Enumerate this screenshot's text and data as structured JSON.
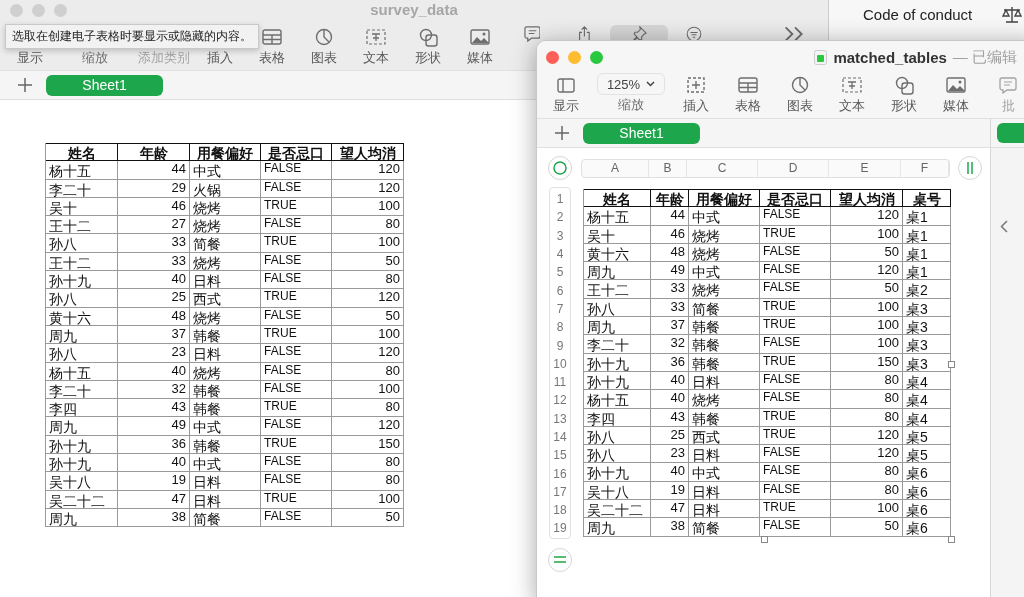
{
  "background_window": {
    "title": "Code of conduct"
  },
  "survey_window": {
    "title": "survey_data",
    "active": false,
    "tooltip": "选取在创建电子表格时要显示或隐藏的内容。",
    "toolbar": [
      {
        "label": "显示",
        "disabled": false
      },
      {
        "kind": "zoom",
        "label": "缩放",
        "disabled": false
      },
      {
        "label": "添加类别",
        "disabled": true
      },
      {
        "label": "插入",
        "disabled": false
      },
      {
        "kind": "table",
        "label": "表格",
        "disabled": false
      },
      {
        "kind": "chart",
        "label": "图表",
        "disabled": false
      },
      {
        "kind": "text",
        "label": "文本",
        "disabled": false
      },
      {
        "kind": "shape",
        "label": "形状",
        "disabled": false
      },
      {
        "kind": "media",
        "label": "媒体",
        "disabled": false
      }
    ],
    "more_tools": [
      {
        "kind": "comment",
        "on": false
      },
      {
        "kind": "share",
        "on": false
      },
      {
        "kind": "pin",
        "on": true
      },
      {
        "kind": "organize",
        "on": false
      },
      {
        "kind": "more",
        "on": false
      }
    ],
    "sheets": [
      {
        "label": "Sheet1",
        "selected": true
      }
    ],
    "table": {
      "columns": [
        {
          "label": "姓名",
          "kind": "text"
        },
        {
          "label": "年龄",
          "kind": "number"
        },
        {
          "label": "用餐偏好",
          "kind": "text"
        },
        {
          "label": "是否忌口",
          "kind": "bool"
        },
        {
          "label": "望人均消",
          "kind": "number"
        }
      ],
      "rows": [
        [
          "杨十五",
          "44",
          "中式",
          "FALSE",
          "120"
        ],
        [
          "李二十",
          "29",
          "火锅",
          "FALSE",
          "120"
        ],
        [
          "吴十",
          "46",
          "烧烤",
          "TRUE",
          "100"
        ],
        [
          "王十二",
          "27",
          "烧烤",
          "FALSE",
          "80"
        ],
        [
          "孙八",
          "33",
          "简餐",
          "TRUE",
          "100"
        ],
        [
          "王十二",
          "33",
          "烧烤",
          "FALSE",
          "50"
        ],
        [
          "孙十九",
          "40",
          "日料",
          "FALSE",
          "80"
        ],
        [
          "孙八",
          "25",
          "西式",
          "TRUE",
          "120"
        ],
        [
          "黄十六",
          "48",
          "烧烤",
          "FALSE",
          "50"
        ],
        [
          "周九",
          "37",
          "韩餐",
          "TRUE",
          "100"
        ],
        [
          "孙八",
          "23",
          "日料",
          "FALSE",
          "120"
        ],
        [
          "杨十五",
          "40",
          "烧烤",
          "FALSE",
          "80"
        ],
        [
          "李二十",
          "32",
          "韩餐",
          "FALSE",
          "100"
        ],
        [
          "李四",
          "43",
          "韩餐",
          "TRUE",
          "80"
        ],
        [
          "周九",
          "49",
          "中式",
          "FALSE",
          "120"
        ],
        [
          "孙十九",
          "36",
          "韩餐",
          "TRUE",
          "150"
        ],
        [
          "孙十九",
          "40",
          "中式",
          "FALSE",
          "80"
        ],
        [
          "吴十八",
          "19",
          "日料",
          "FALSE",
          "80"
        ],
        [
          "吴二十二",
          "47",
          "日料",
          "TRUE",
          "100"
        ],
        [
          "周九",
          "38",
          "简餐",
          "FALSE",
          "50"
        ]
      ]
    }
  },
  "matched_window": {
    "title": "matched_tables",
    "status": "— 已编辑",
    "active": true,
    "toolbar": [
      {
        "kind": "panel",
        "label": "显示",
        "disabled": false
      },
      {
        "kind": "zoom",
        "label": "缩放",
        "value": "125%",
        "disabled": false
      },
      {
        "kind": "insert",
        "label": "插入",
        "disabled": false
      },
      {
        "kind": "table",
        "label": "表格",
        "disabled": false
      },
      {
        "kind": "chart",
        "label": "图表",
        "disabled": false
      },
      {
        "kind": "text",
        "label": "文本",
        "disabled": false
      },
      {
        "kind": "shape",
        "label": "形状",
        "disabled": false
      },
      {
        "kind": "media",
        "label": "媒体",
        "disabled": false
      },
      {
        "kind": "comment",
        "label": "批",
        "disabled": true
      }
    ],
    "sheets": [
      {
        "label": "Sheet1",
        "selected": true
      }
    ],
    "column_letters": [
      "A",
      "B",
      "C",
      "D",
      "E",
      "F"
    ],
    "row_numbers": [
      "1",
      "2",
      "3",
      "4",
      "5",
      "6",
      "7",
      "8",
      "9",
      "10",
      "11",
      "12",
      "13",
      "14",
      "15",
      "16",
      "17",
      "18",
      "19"
    ],
    "table": {
      "columns": [
        {
          "label": "姓名",
          "kind": "text"
        },
        {
          "label": "年龄",
          "kind": "number"
        },
        {
          "label": "用餐偏好",
          "kind": "text"
        },
        {
          "label": "是否忌口",
          "kind": "bool"
        },
        {
          "label": "望人均消",
          "kind": "number"
        },
        {
          "label": "桌号",
          "kind": "text"
        }
      ],
      "rows": [
        [
          "杨十五",
          "44",
          "中式",
          "FALSE",
          "120",
          "桌1"
        ],
        [
          "吴十",
          "46",
          "烧烤",
          "TRUE",
          "100",
          "桌1"
        ],
        [
          "黄十六",
          "48",
          "烧烤",
          "FALSE",
          "50",
          "桌1"
        ],
        [
          "周九",
          "49",
          "中式",
          "FALSE",
          "120",
          "桌1"
        ],
        [
          "王十二",
          "33",
          "烧烤",
          "FALSE",
          "50",
          "桌2"
        ],
        [
          "孙八",
          "33",
          "简餐",
          "TRUE",
          "100",
          "桌3"
        ],
        [
          "周九",
          "37",
          "韩餐",
          "TRUE",
          "100",
          "桌3"
        ],
        [
          "李二十",
          "32",
          "韩餐",
          "FALSE",
          "100",
          "桌3"
        ],
        [
          "孙十九",
          "36",
          "韩餐",
          "TRUE",
          "150",
          "桌3"
        ],
        [
          "孙十九",
          "40",
          "日料",
          "FALSE",
          "80",
          "桌4"
        ],
        [
          "杨十五",
          "40",
          "烧烤",
          "FALSE",
          "80",
          "桌4"
        ],
        [
          "李四",
          "43",
          "韩餐",
          "TRUE",
          "80",
          "桌4"
        ],
        [
          "孙八",
          "25",
          "西式",
          "TRUE",
          "120",
          "桌5"
        ],
        [
          "孙八",
          "23",
          "日料",
          "FALSE",
          "120",
          "桌5"
        ],
        [
          "孙十九",
          "40",
          "中式",
          "FALSE",
          "80",
          "桌6"
        ],
        [
          "吴十八",
          "19",
          "日料",
          "FALSE",
          "80",
          "桌6"
        ],
        [
          "吴二十二",
          "47",
          "日料",
          "TRUE",
          "100",
          "桌6"
        ],
        [
          "周九",
          "38",
          "简餐",
          "FALSE",
          "50",
          "桌6"
        ]
      ]
    }
  }
}
